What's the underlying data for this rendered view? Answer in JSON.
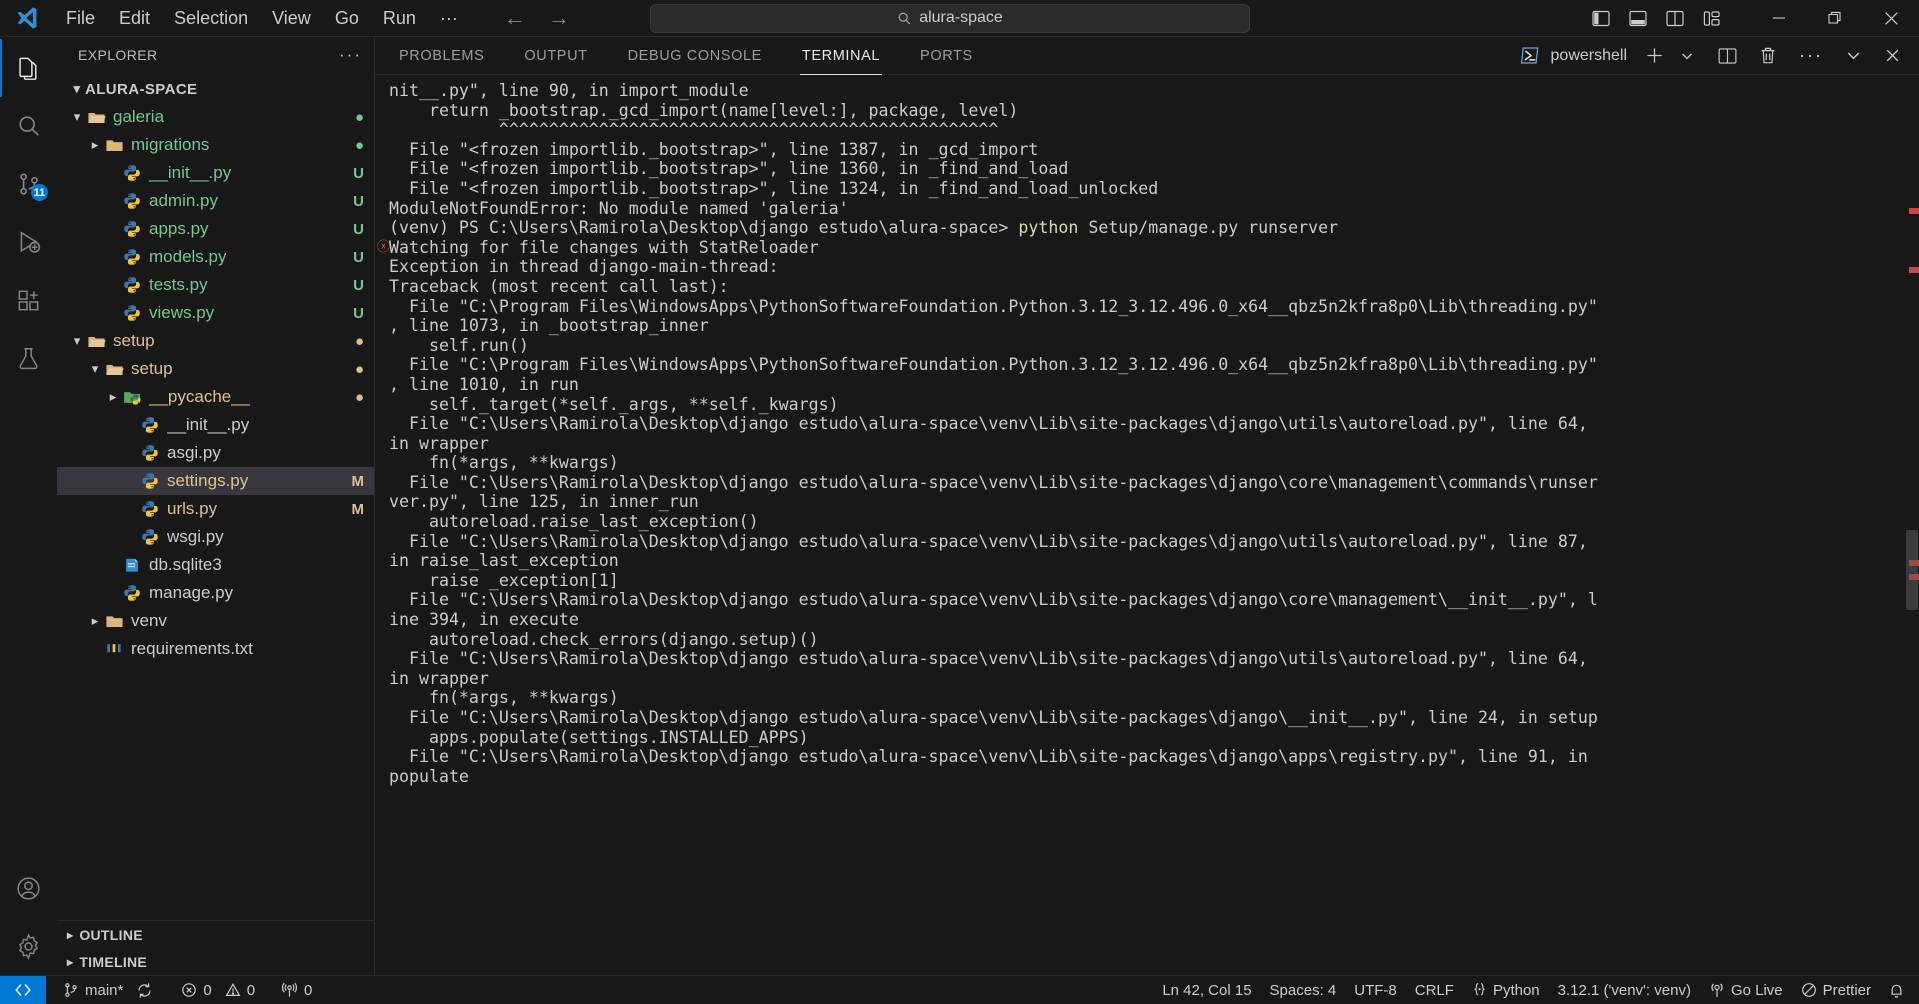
{
  "titlebar": {
    "menu": [
      "File",
      "Edit",
      "Selection",
      "View",
      "Go",
      "Run",
      "···"
    ],
    "back_icon": "arrow-left-icon",
    "forward_icon": "arrow-right-icon",
    "search_value": "alura-space",
    "search_icon": "search-icon",
    "layout_icons": [
      "toggle-primary-sidebar-icon",
      "toggle-panel-icon",
      "toggle-secondary-sidebar-icon",
      "customize-layout-icon"
    ],
    "window_controls": [
      "minimize-icon",
      "restore-icon",
      "close-icon"
    ]
  },
  "activitybar": {
    "items": [
      {
        "name": "explorer",
        "icon": "files-icon",
        "active": true,
        "badge": ""
      },
      {
        "name": "search",
        "icon": "search-icon",
        "active": false,
        "badge": ""
      },
      {
        "name": "source-control",
        "icon": "source-control-icon",
        "active": false,
        "badge": "11"
      },
      {
        "name": "run-and-debug",
        "icon": "debug-icon",
        "active": false,
        "badge": ""
      },
      {
        "name": "extensions",
        "icon": "extensions-icon",
        "active": false,
        "badge": ""
      },
      {
        "name": "testing",
        "icon": "beaker-icon",
        "active": false,
        "badge": ""
      }
    ],
    "bottom_items": [
      {
        "name": "accounts",
        "icon": "account-icon"
      },
      {
        "name": "manage",
        "icon": "gear-icon"
      }
    ]
  },
  "sidebar": {
    "title": "EXPLORER",
    "more_actions": "···",
    "root": {
      "label": "ALURA-SPACE",
      "expanded": true
    },
    "tree": [
      {
        "label": "galeria",
        "indent": 1,
        "type": "folder",
        "twisty": "v",
        "color": "green",
        "badge": "●",
        "badge_color": "green"
      },
      {
        "label": "migrations",
        "indent": 2,
        "type": "folder",
        "twisty": ">",
        "color": "green",
        "badge": "●",
        "badge_color": "green"
      },
      {
        "label": "__init__.py",
        "indent": 3,
        "type": "python",
        "twisty": "",
        "color": "green",
        "badge": "U",
        "badge_color": "green"
      },
      {
        "label": "admin.py",
        "indent": 3,
        "type": "python",
        "twisty": "",
        "color": "green",
        "badge": "U",
        "badge_color": "green"
      },
      {
        "label": "apps.py",
        "indent": 3,
        "type": "python",
        "twisty": "",
        "color": "green",
        "badge": "U",
        "badge_color": "green"
      },
      {
        "label": "models.py",
        "indent": 3,
        "type": "python",
        "twisty": "",
        "color": "green",
        "badge": "U",
        "badge_color": "green"
      },
      {
        "label": "tests.py",
        "indent": 3,
        "type": "python",
        "twisty": "",
        "color": "green",
        "badge": "U",
        "badge_color": "green"
      },
      {
        "label": "views.py",
        "indent": 3,
        "type": "python",
        "twisty": "",
        "color": "green",
        "badge": "U",
        "badge_color": "green"
      },
      {
        "label": "setup",
        "indent": 1,
        "type": "folder",
        "twisty": "v",
        "color": "amber",
        "badge": "●",
        "badge_color": "amber"
      },
      {
        "label": "setup",
        "indent": 2,
        "type": "folder",
        "twisty": "v",
        "color": "amber",
        "badge": "●",
        "badge_color": "amber"
      },
      {
        "label": "__pycache__",
        "indent": 3,
        "type": "pyfolder",
        "twisty": ">",
        "color": "amber",
        "badge": "●",
        "badge_color": "amber"
      },
      {
        "label": "__init__.py",
        "indent": 4,
        "type": "python",
        "twisty": "",
        "color": "gray",
        "badge": "",
        "badge_color": ""
      },
      {
        "label": "asgi.py",
        "indent": 4,
        "type": "python",
        "twisty": "",
        "color": "gray",
        "badge": "",
        "badge_color": ""
      },
      {
        "label": "settings.py",
        "indent": 4,
        "type": "python",
        "twisty": "",
        "color": "amber",
        "badge": "M",
        "badge_color": "amber",
        "selected": true
      },
      {
        "label": "urls.py",
        "indent": 4,
        "type": "python",
        "twisty": "",
        "color": "amber",
        "badge": "M",
        "badge_color": "amber"
      },
      {
        "label": "wsgi.py",
        "indent": 4,
        "type": "python",
        "twisty": "",
        "color": "gray",
        "badge": "",
        "badge_color": ""
      },
      {
        "label": "db.sqlite3",
        "indent": 3,
        "type": "db",
        "twisty": "",
        "color": "gray",
        "badge": "",
        "badge_color": ""
      },
      {
        "label": "manage.py",
        "indent": 3,
        "type": "python",
        "twisty": "",
        "color": "gray",
        "badge": "",
        "badge_color": ""
      },
      {
        "label": "venv",
        "indent": 2,
        "type": "folder",
        "twisty": ">",
        "color": "gray",
        "badge": "",
        "badge_color": ""
      },
      {
        "label": "requirements.txt",
        "indent": 2,
        "type": "pip",
        "twisty": "",
        "color": "gray",
        "badge": "",
        "badge_color": ""
      }
    ],
    "sections": [
      {
        "label": "OUTLINE",
        "twisty": ">"
      },
      {
        "label": "TIMELINE",
        "twisty": ">"
      }
    ]
  },
  "panel": {
    "tabs": [
      {
        "label": "PROBLEMS",
        "active": false
      },
      {
        "label": "OUTPUT",
        "active": false
      },
      {
        "label": "DEBUG CONSOLE",
        "active": false
      },
      {
        "label": "TERMINAL",
        "active": true
      },
      {
        "label": "PORTS",
        "active": false
      }
    ],
    "terminal_name": "powershell",
    "terminal_icon": "powershell-icon",
    "actions": [
      {
        "name": "new-terminal",
        "icon": "plus-icon"
      },
      {
        "name": "terminal-profile-dropdown",
        "icon": "chevron-down-icon"
      },
      {
        "name": "split-terminal",
        "icon": "split-icon"
      },
      {
        "name": "kill-terminal",
        "icon": "trash-icon"
      },
      {
        "name": "terminal-more-actions",
        "icon": "ellipsis-icon"
      },
      {
        "name": "hide-panel",
        "icon": "chevron-down-icon"
      },
      {
        "name": "close-panel",
        "icon": "close-icon"
      }
    ]
  },
  "terminal": {
    "lines": [
      {
        "text": "nit__.py\", line 90, in import_module",
        "error": false
      },
      {
        "text": "    return _bootstrap._gcd_import(name[level:], package, level)",
        "error": false
      },
      {
        "text": "           ^^^^^^^^^^^^^^^^^^^^^^^^^^^^^^^^^^^^^^^^^^^^^^^^^^",
        "error": false
      },
      {
        "text": "  File \"<frozen importlib._bootstrap>\", line 1387, in _gcd_import",
        "error": false
      },
      {
        "text": "  File \"<frozen importlib._bootstrap>\", line 1360, in _find_and_load",
        "error": false
      },
      {
        "text": "  File \"<frozen importlib._bootstrap>\", line 1324, in _find_and_load_unlocked",
        "error": false
      },
      {
        "text": "ModuleNotFoundError: No module named 'galeria'",
        "error": false
      },
      {
        "prompt": "(venv) PS C:\\Users\\Ramirola\\Desktop\\django estudo\\alura-space> ",
        "cmd": "python",
        "args": " Setup/manage.py runserver",
        "error": false
      },
      {
        "text": "Watching for file changes with StatReloader",
        "error": true
      },
      {
        "text": "Exception in thread django-main-thread:",
        "error": false
      },
      {
        "text": "Traceback (most recent call last):",
        "error": false
      },
      {
        "text": "  File \"C:\\Program Files\\WindowsApps\\PythonSoftwareFoundation.Python.3.12_3.12.496.0_x64__qbz5n2kfra8p0\\Lib\\threading.py\"",
        "error": false
      },
      {
        "text": ", line 1073, in _bootstrap_inner",
        "error": false
      },
      {
        "text": "    self.run()",
        "error": false
      },
      {
        "text": "  File \"C:\\Program Files\\WindowsApps\\PythonSoftwareFoundation.Python.3.12_3.12.496.0_x64__qbz5n2kfra8p0\\Lib\\threading.py\"",
        "error": false
      },
      {
        "text": ", line 1010, in run",
        "error": false
      },
      {
        "text": "    self._target(*self._args, **self._kwargs)",
        "error": false
      },
      {
        "text": "  File \"C:\\Users\\Ramirola\\Desktop\\django estudo\\alura-space\\venv\\Lib\\site-packages\\django\\utils\\autoreload.py\", line 64,",
        "error": false
      },
      {
        "text": "in wrapper",
        "error": false
      },
      {
        "text": "    fn(*args, **kwargs)",
        "error": false
      },
      {
        "text": "  File \"C:\\Users\\Ramirola\\Desktop\\django estudo\\alura-space\\venv\\Lib\\site-packages\\django\\core\\management\\commands\\runser",
        "error": false
      },
      {
        "text": "ver.py\", line 125, in inner_run",
        "error": false
      },
      {
        "text": "    autoreload.raise_last_exception()",
        "error": false
      },
      {
        "text": "  File \"C:\\Users\\Ramirola\\Desktop\\django estudo\\alura-space\\venv\\Lib\\site-packages\\django\\utils\\autoreload.py\", line 87,",
        "error": false
      },
      {
        "text": "in raise_last_exception",
        "error": false
      },
      {
        "text": "    raise _exception[1]",
        "error": false
      },
      {
        "text": "  File \"C:\\Users\\Ramirola\\Desktop\\django estudo\\alura-space\\venv\\Lib\\site-packages\\django\\core\\management\\__init__.py\", l",
        "error": false
      },
      {
        "text": "ine 394, in execute",
        "error": false
      },
      {
        "text": "    autoreload.check_errors(django.setup)()",
        "error": false
      },
      {
        "text": "  File \"C:\\Users\\Ramirola\\Desktop\\django estudo\\alura-space\\venv\\Lib\\site-packages\\django\\utils\\autoreload.py\", line 64,",
        "error": false
      },
      {
        "text": "in wrapper",
        "error": false
      },
      {
        "text": "    fn(*args, **kwargs)",
        "error": false
      },
      {
        "text": "  File \"C:\\Users\\Ramirola\\Desktop\\django estudo\\alura-space\\venv\\Lib\\site-packages\\django\\__init__.py\", line 24, in setup",
        "error": false
      },
      {
        "text": "    apps.populate(settings.INSTALLED_APPS)",
        "error": false
      },
      {
        "text": "  File \"C:\\Users\\Ramirola\\Desktop\\django estudo\\alura-space\\venv\\Lib\\site-packages\\django\\apps\\registry.py\", line 91, in",
        "error": false
      },
      {
        "text": "populate",
        "error": false
      }
    ]
  },
  "statusbar": {
    "remote_icon": "remote-window-icon",
    "left": [
      {
        "name": "branch",
        "icon": "git-branch-icon",
        "label": "main*"
      },
      {
        "name": "sync",
        "icon": "sync-icon",
        "label": ""
      },
      {
        "name": "errors",
        "icon": "error-icon",
        "label": "0"
      },
      {
        "name": "warnings",
        "icon": "warning-icon",
        "label": "0"
      },
      {
        "name": "ports",
        "icon": "radio-tower-icon",
        "label": "0"
      }
    ],
    "right": [
      {
        "name": "cursor-position",
        "icon": "",
        "label": "Ln 42, Col 15"
      },
      {
        "name": "indentation",
        "icon": "",
        "label": "Spaces: 4"
      },
      {
        "name": "encoding",
        "icon": "",
        "label": "UTF-8"
      },
      {
        "name": "eol",
        "icon": "",
        "label": "CRLF"
      },
      {
        "name": "language-mode",
        "icon": "python-braces-icon",
        "label": "Python"
      },
      {
        "name": "interpreter",
        "icon": "",
        "label": "3.12.1 ('venv': venv)"
      },
      {
        "name": "go-live",
        "icon": "broadcast-icon",
        "label": "Go Live"
      },
      {
        "name": "prettier",
        "icon": "prettier-icon",
        "label": "Prettier"
      },
      {
        "name": "notifications",
        "icon": "bell-icon",
        "label": ""
      }
    ]
  }
}
